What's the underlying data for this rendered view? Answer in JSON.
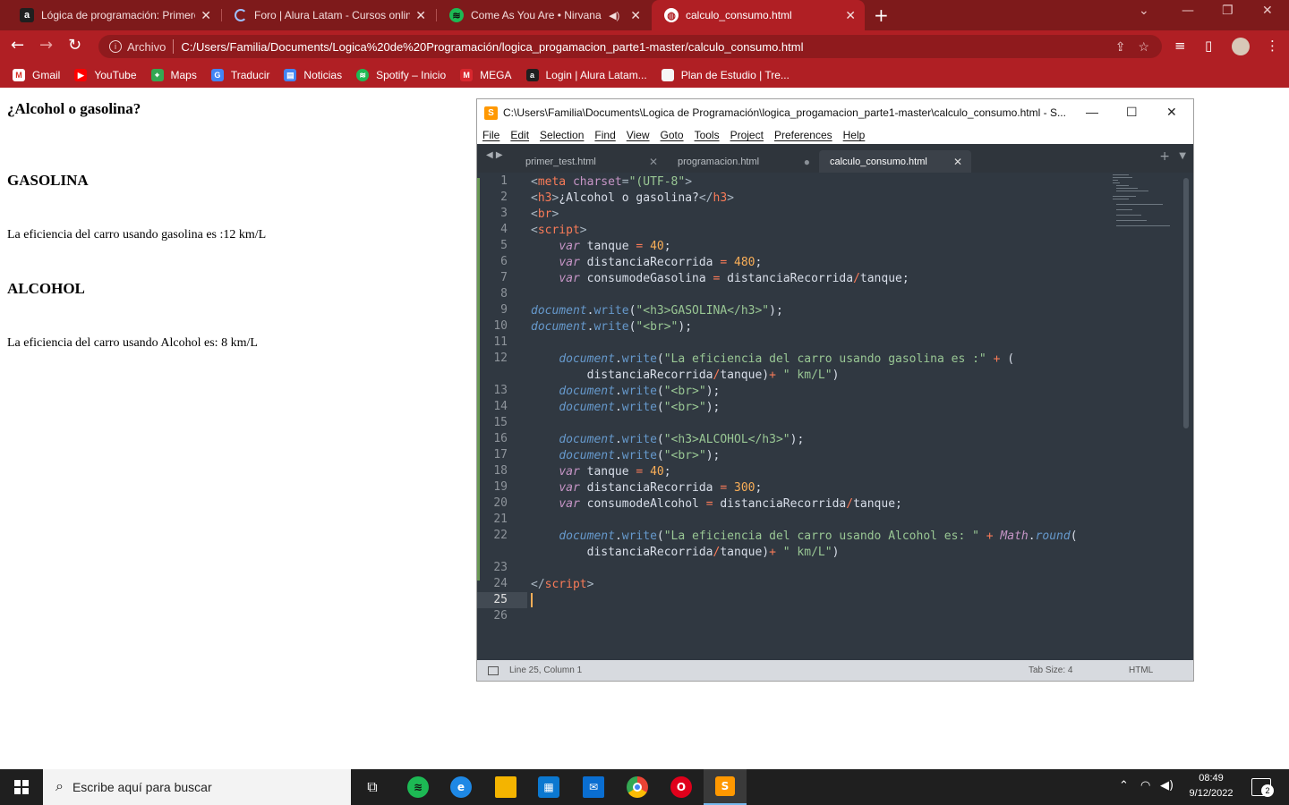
{
  "browser": {
    "tabs": [
      {
        "title": "Lógica de programación: Primero",
        "icon": "alura-icon"
      },
      {
        "title": "Foro | Alura Latam - Cursos onlin",
        "icon": "loading-icon"
      },
      {
        "title": "Come As You Are • Nirvana",
        "icon": "spotify-icon"
      },
      {
        "title": "calculo_consumo.html",
        "icon": "globe-icon"
      }
    ],
    "address": {
      "scheme": "Archivo",
      "url": "C:/Users/Familia/Documents/Logica%20de%20Programación/logica_progamacion_parte1-master/calculo_consumo.html"
    },
    "bookmarks": [
      "Gmail",
      "YouTube",
      "Maps",
      "Traducir",
      "Noticias",
      "Spotify – Inicio",
      "MEGA",
      "Login | Alura Latam...",
      "Plan de Estudio | Tre..."
    ]
  },
  "page": {
    "heading": "¿Alcohol o gasolina?",
    "gasolina_heading": "GASOLINA",
    "gasolina_text": "La eficiencia del carro usando gasolina es :12 km/L",
    "alcohol_heading": "ALCOHOL",
    "alcohol_text": "La eficiencia del carro usando Alcohol es: 8 km/L"
  },
  "editor": {
    "title": "C:\\Users\\Familia\\Documents\\Logica de Programación\\logica_progamacion_parte1-master\\calculo_consumo.html - S...",
    "menu": [
      "File",
      "Edit",
      "Selection",
      "Find",
      "View",
      "Goto",
      "Tools",
      "Project",
      "Preferences",
      "Help"
    ],
    "tabs": [
      "primer_test.html",
      "programacion.html",
      "calculo_consumo.html"
    ],
    "line_numbers": [
      "1",
      "2",
      "3",
      "4",
      "5",
      "6",
      "7",
      "8",
      "9",
      "10",
      "11",
      "12",
      "",
      "13",
      "14",
      "15",
      "16",
      "17",
      "18",
      "19",
      "20",
      "21",
      "22",
      "",
      "23",
      "24",
      "25",
      "26"
    ],
    "status": {
      "position": "Line 25, Column 1",
      "tab_size": "Tab Size: 4",
      "syntax": "HTML"
    }
  },
  "taskbar": {
    "search_placeholder": "Escribe aquí para buscar",
    "time": "08:49",
    "date": "9/12/2022",
    "notifications": "2"
  }
}
